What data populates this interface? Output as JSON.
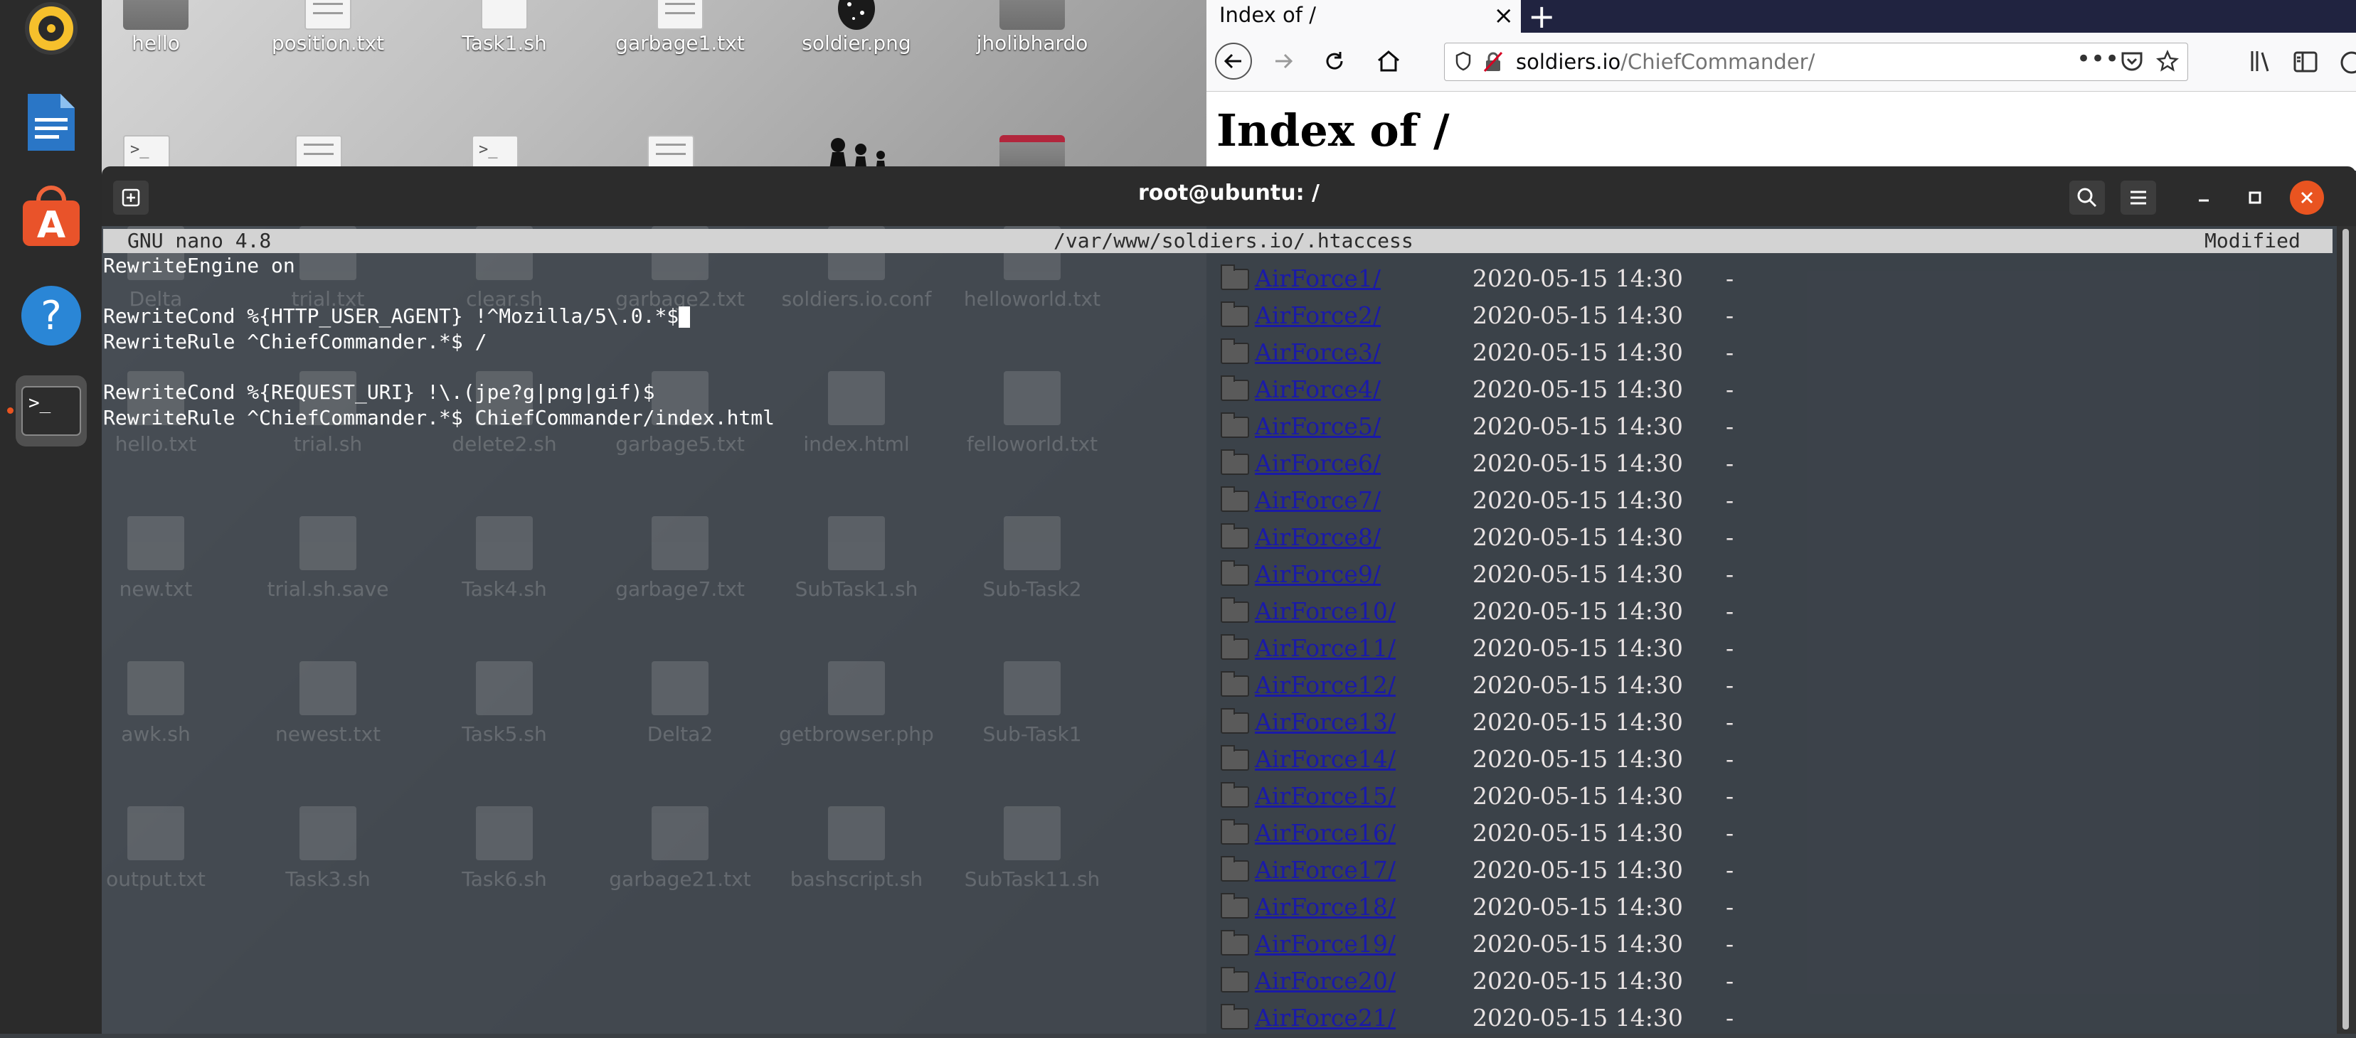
{
  "desktop": {
    "top_icons": [
      {
        "label": "hello",
        "kind": "folder"
      },
      {
        "label": "position.txt",
        "kind": "doc"
      },
      {
        "label": "Task1.sh",
        "kind": "sh"
      },
      {
        "label": "garbage1.txt",
        "kind": "doc"
      },
      {
        "label": "soldier.png",
        "kind": "image"
      },
      {
        "label": "jholibhardo",
        "kind": "folder"
      }
    ],
    "ghost_icons": [
      [
        "Delta",
        "trial.txt",
        "clear.sh",
        "garbage2.txt",
        "soldiers.io.conf",
        "helloworld.txt"
      ],
      [
        "hello.txt",
        "trial.sh",
        "delete2.sh",
        "garbage5.txt",
        "index.html",
        "felloworld.txt"
      ],
      [
        "new.txt",
        "trial.sh.save",
        "Task4.sh",
        "garbage7.txt",
        "SubTask1.sh",
        "Sub-Task2"
      ],
      [
        "awk.sh",
        "newest.txt",
        "Task5.sh",
        "Delta2",
        "getbrowser.php",
        "Sub-Task1"
      ],
      [
        "output.txt",
        "Task3.sh",
        "Task6.sh",
        "garbage21.txt",
        "bashscript.sh",
        "SubTask11.sh"
      ]
    ]
  },
  "dock": {
    "items": [
      {
        "name": "rhythmbox-icon"
      },
      {
        "name": "libreoffice-writer-icon"
      },
      {
        "name": "software-center-icon"
      },
      {
        "name": "help-icon"
      },
      {
        "name": "terminal-icon"
      }
    ]
  },
  "browser": {
    "tab_title": "Index of /",
    "url_host": "soldiers.io",
    "url_path": "/ChiefCommander/",
    "page_heading": "Index of /",
    "listing": [
      {
        "name": "AirForce1/",
        "date": "2020-05-15 14:30",
        "size": "-"
      },
      {
        "name": "AirForce2/",
        "date": "2020-05-15 14:30",
        "size": "-"
      },
      {
        "name": "AirForce3/",
        "date": "2020-05-15 14:30",
        "size": "-"
      },
      {
        "name": "AirForce4/",
        "date": "2020-05-15 14:30",
        "size": "-"
      },
      {
        "name": "AirForce5/",
        "date": "2020-05-15 14:30",
        "size": "-"
      },
      {
        "name": "AirForce6/",
        "date": "2020-05-15 14:30",
        "size": "-"
      },
      {
        "name": "AirForce7/",
        "date": "2020-05-15 14:30",
        "size": "-"
      },
      {
        "name": "AirForce8/",
        "date": "2020-05-15 14:30",
        "size": "-"
      },
      {
        "name": "AirForce9/",
        "date": "2020-05-15 14:30",
        "size": "-"
      },
      {
        "name": "AirForce10/",
        "date": "2020-05-15 14:30",
        "size": "-"
      },
      {
        "name": "AirForce11/",
        "date": "2020-05-15 14:30",
        "size": "-"
      },
      {
        "name": "AirForce12/",
        "date": "2020-05-15 14:30",
        "size": "-"
      },
      {
        "name": "AirForce13/",
        "date": "2020-05-15 14:30",
        "size": "-"
      },
      {
        "name": "AirForce14/",
        "date": "2020-05-15 14:30",
        "size": "-"
      },
      {
        "name": "AirForce15/",
        "date": "2020-05-15 14:30",
        "size": "-"
      },
      {
        "name": "AirForce16/",
        "date": "2020-05-15 14:30",
        "size": "-"
      },
      {
        "name": "AirForce17/",
        "date": "2020-05-15 14:30",
        "size": "-"
      },
      {
        "name": "AirForce18/",
        "date": "2020-05-15 14:30",
        "size": "-"
      },
      {
        "name": "AirForce19/",
        "date": "2020-05-15 14:30",
        "size": "-"
      },
      {
        "name": "AirForce20/",
        "date": "2020-05-15 14:30",
        "size": "-"
      },
      {
        "name": "AirForce21/",
        "date": "2020-05-15 14:30",
        "size": "-"
      }
    ]
  },
  "terminal": {
    "title": "root@ubuntu: /",
    "nano": {
      "version": "GNU nano 4.8",
      "file": "/var/www/soldiers.io/.htaccess",
      "status": "Modified"
    },
    "lines": [
      "RewriteEngine on",
      "",
      "RewriteCond %{HTTP_USER_AGENT} !^Mozilla/5\\.0.*$",
      "RewriteRule ^ChiefCommander.*$ /",
      "",
      "RewriteCond %{REQUEST_URI} !\\.(jpe?g|png|gif)$",
      "RewriteRule ^ChiefCommander.*$ ChiefCommander/index.html"
    ]
  },
  "colors": {
    "dock_bg": "#2b2b2b",
    "terminal_header": "#2c2c2c",
    "close_button": "#e95420",
    "browser_tabbar": "#202340",
    "link": "#1a1aa8"
  }
}
